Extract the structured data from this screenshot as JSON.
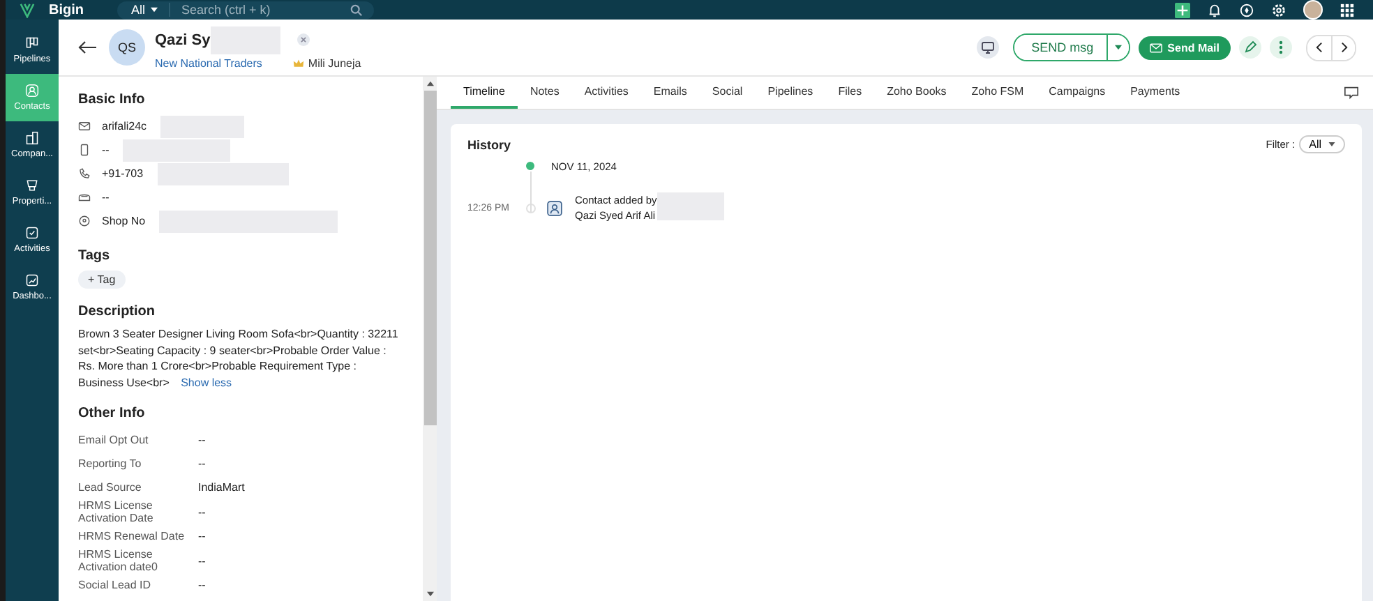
{
  "top_bar": {
    "logo": "Bigin",
    "search_scope": "All",
    "search_placeholder": "Search (ctrl + k)"
  },
  "sidebar": {
    "items": [
      {
        "label": "Pipelines",
        "kind": "pipelines",
        "selected": false
      },
      {
        "label": "Contacts",
        "kind": "contacts",
        "selected": true
      },
      {
        "label": "Compan...",
        "kind": "companies",
        "selected": false
      },
      {
        "label": "Properti...",
        "kind": "properties",
        "selected": false
      },
      {
        "label": "Activities",
        "kind": "activities",
        "selected": false
      },
      {
        "label": "Dashbo...",
        "kind": "dashboards",
        "selected": false
      }
    ]
  },
  "contact": {
    "initials": "QS",
    "name": "Qazi Sy",
    "name_redacted": true,
    "company": "New National Traders",
    "owner": "Mili Juneja"
  },
  "actions": {
    "message_button": "SEND msg",
    "mail_button": "Send Mail"
  },
  "basic_info": {
    "title": "Basic Info",
    "rows": [
      {
        "kind": "mail",
        "value": "arifali24c",
        "redacted": true
      },
      {
        "kind": "mobile",
        "value": "--",
        "redacted": true
      },
      {
        "kind": "phone",
        "value": "+91-703",
        "redacted": true
      },
      {
        "kind": "fax",
        "value": "--",
        "redacted": false
      },
      {
        "kind": "location",
        "value": "Shop No",
        "redacted": true
      }
    ]
  },
  "tags": {
    "title": "Tags",
    "add_button": "+ Tag"
  },
  "description": {
    "title": "Description",
    "text": "Brown 3 Seater Designer Living Room Sofa<br>Quantity : 32211 set<br>Seating Capacity : 9 seater<br>Probable Order Value : Rs. More than 1 Crore<br>Probable Requirement Type : Business Use<br>",
    "toggle": "Show less"
  },
  "other_info": {
    "title": "Other Info",
    "fields": [
      {
        "label": "Email Opt Out",
        "value": "--"
      },
      {
        "label": "Reporting To",
        "value": "--"
      },
      {
        "label": "Lead Source",
        "value": "IndiaMart"
      },
      {
        "label": "HRMS License Activation Date",
        "value": "--"
      },
      {
        "label": "HRMS Renewal Date",
        "value": "--"
      },
      {
        "label": "HRMS License Activation date0",
        "value": "--"
      },
      {
        "label": "Social Lead ID",
        "value": "--"
      }
    ]
  },
  "tabs": [
    {
      "label": "Timeline",
      "selected": true
    },
    {
      "label": "Notes",
      "selected": false
    },
    {
      "label": "Activities",
      "selected": false
    },
    {
      "label": "Emails",
      "selected": false
    },
    {
      "label": "Social",
      "selected": false
    },
    {
      "label": "Pipelines",
      "selected": false
    },
    {
      "label": "Files",
      "selected": false
    },
    {
      "label": "Zoho Books",
      "selected": false
    },
    {
      "label": "Zoho FSM",
      "selected": false
    },
    {
      "label": "Campaigns",
      "selected": false
    },
    {
      "label": "Payments",
      "selected": false
    }
  ],
  "history": {
    "title": "History",
    "filter_label": "Filter :",
    "filter_value": "All",
    "groups": [
      {
        "date": "NOV 11, 2024",
        "events": [
          {
            "time": "12:26 PM",
            "line1": "Contact added by",
            "line2": "Qazi Syed Arif Ali",
            "redacted": true
          }
        ]
      }
    ]
  }
}
